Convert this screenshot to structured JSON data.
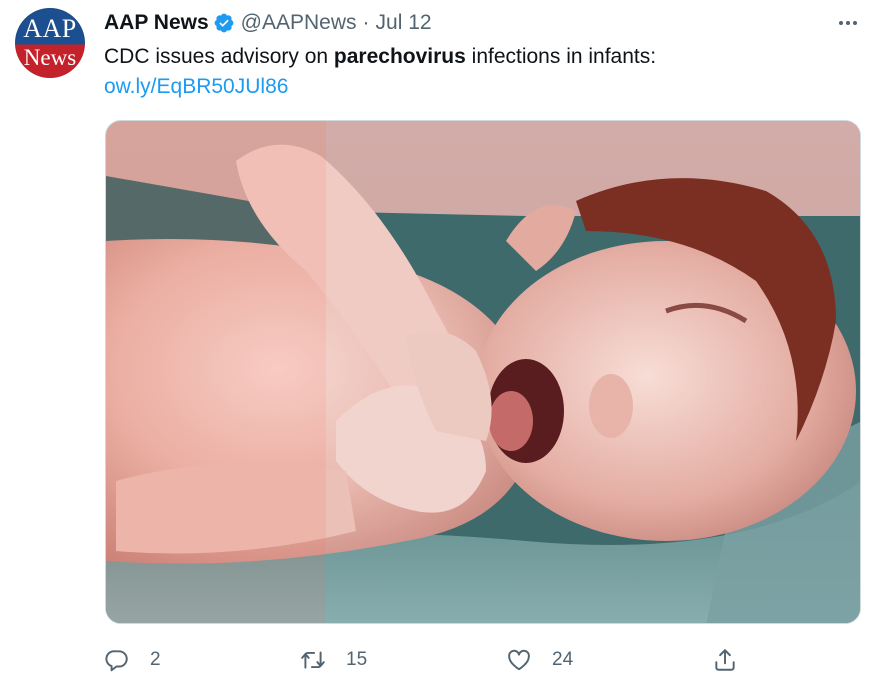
{
  "tweet": {
    "author": {
      "display_name": "AAP News",
      "handle": "@AAPNews",
      "verified": true,
      "avatar_text_line1": "AAP",
      "avatar_text_line2": "News"
    },
    "separator": "·",
    "date": "Jul 12",
    "text_prefix": "CDC issues advisory on ",
    "text_bold": "parechovirus",
    "text_suffix": " infections in infants:",
    "link": "ow.ly/EqBR50JUl86",
    "media": {
      "icon": "newborn-photo"
    },
    "actions": {
      "reply_count": "2",
      "retweet_count": "15",
      "like_count": "24"
    }
  },
  "colors": {
    "link": "#1d9bf0",
    "secondary_text": "#536471",
    "verified": "#1d9bf0",
    "avatar_blue": "#1b4f8f",
    "avatar_red": "#c4222b"
  }
}
